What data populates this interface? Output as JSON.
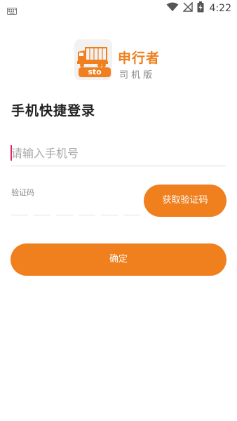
{
  "status_bar": {
    "time": "4:22",
    "icons": [
      "keyboard-icon",
      "wifi-icon",
      "no-signal-icon",
      "battery-charging-icon"
    ]
  },
  "logo": {
    "badge_text": "sto",
    "brand_name": "申行者",
    "subtitle": "司机版",
    "colors": {
      "brand": "#f07f1e"
    }
  },
  "login": {
    "title": "手机快捷登录",
    "phone_placeholder": "请输入手机号",
    "code_label": "验证码",
    "code_slots": 6,
    "get_code_label": "获取验证码",
    "confirm_label": "确定"
  },
  "colors": {
    "accent": "#f07f1e",
    "caret": "#e0245e",
    "placeholder": "#a8a8a8"
  }
}
